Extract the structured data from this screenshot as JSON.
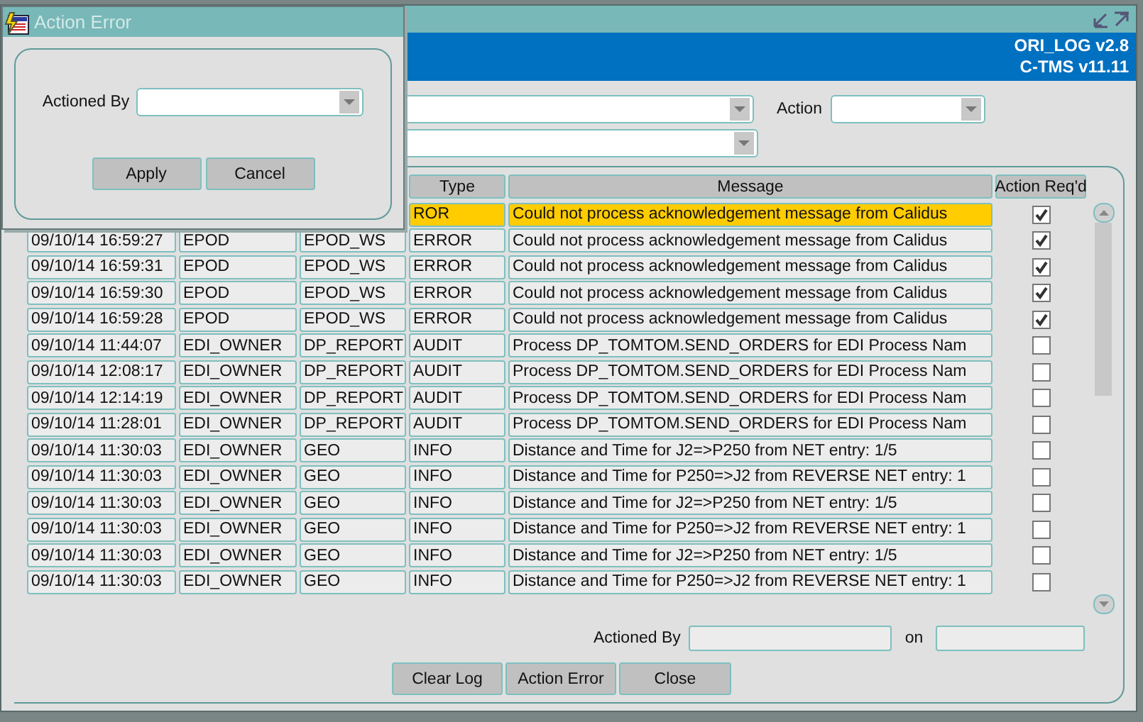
{
  "window": {
    "banner_lines": [
      "ORI_LOG v2.8",
      "C-TMS v11.11"
    ]
  },
  "filters": {
    "action_label": "Action"
  },
  "table": {
    "columns": [
      "Type",
      "Message",
      "Action Req'd"
    ],
    "rows": [
      {
        "type": "ROR",
        "message": "Could not process acknowledgement message from Calidus",
        "action_required": true,
        "selected": true
      },
      {
        "time": "09/10/14 16:59:27",
        "user": "EPOD",
        "module": "EPOD_WS",
        "type": "ERROR",
        "message": "Could not process acknowledgement message from Calidus",
        "action_required": true,
        "selected": false
      },
      {
        "time": "09/10/14 16:59:31",
        "user": "EPOD",
        "module": "EPOD_WS",
        "type": "ERROR",
        "message": "Could not process acknowledgement message from Calidus",
        "action_required": true,
        "selected": false
      },
      {
        "time": "09/10/14 16:59:30",
        "user": "EPOD",
        "module": "EPOD_WS",
        "type": "ERROR",
        "message": "Could not process acknowledgement message from Calidus",
        "action_required": true,
        "selected": false
      },
      {
        "time": "09/10/14 16:59:28",
        "user": "EPOD",
        "module": "EPOD_WS",
        "type": "ERROR",
        "message": "Could not process acknowledgement message from Calidus",
        "action_required": true,
        "selected": false
      },
      {
        "time": "09/10/14 11:44:07",
        "user": "EDI_OWNER",
        "module": "DP_REPORT",
        "type": "AUDIT",
        "message": "Process DP_TOMTOM.SEND_ORDERS for EDI Process Nam",
        "action_required": false,
        "selected": false
      },
      {
        "time": "09/10/14 12:08:17",
        "user": "EDI_OWNER",
        "module": "DP_REPORT",
        "type": "AUDIT",
        "message": "Process DP_TOMTOM.SEND_ORDERS for EDI Process Nam",
        "action_required": false,
        "selected": false
      },
      {
        "time": "09/10/14 12:14:19",
        "user": "EDI_OWNER",
        "module": "DP_REPORT",
        "type": "AUDIT",
        "message": "Process DP_TOMTOM.SEND_ORDERS for EDI Process Nam",
        "action_required": false,
        "selected": false
      },
      {
        "time": "09/10/14 11:28:01",
        "user": "EDI_OWNER",
        "module": "DP_REPORT",
        "type": "AUDIT",
        "message": "Process DP_TOMTOM.SEND_ORDERS for EDI Process Nam",
        "action_required": false,
        "selected": false
      },
      {
        "time": "09/10/14 11:30:03",
        "user": "EDI_OWNER",
        "module": "GEO",
        "type": "INFO",
        "message": "Distance and Time for J2=>P250 from NET entry: 1/5",
        "action_required": false,
        "selected": false
      },
      {
        "time": "09/10/14 11:30:03",
        "user": "EDI_OWNER",
        "module": "GEO",
        "type": "INFO",
        "message": "Distance and Time for P250=>J2 from REVERSE NET entry: 1",
        "action_required": false,
        "selected": false
      },
      {
        "time": "09/10/14 11:30:03",
        "user": "EDI_OWNER",
        "module": "GEO",
        "type": "INFO",
        "message": "Distance and Time for J2=>P250 from NET entry: 1/5",
        "action_required": false,
        "selected": false
      },
      {
        "time": "09/10/14 11:30:03",
        "user": "EDI_OWNER",
        "module": "GEO",
        "type": "INFO",
        "message": "Distance and Time for P250=>J2 from REVERSE NET entry: 1",
        "action_required": false,
        "selected": false
      },
      {
        "time": "09/10/14 11:30:03",
        "user": "EDI_OWNER",
        "module": "GEO",
        "type": "INFO",
        "message": "Distance and Time for J2=>P250 from NET entry: 1/5",
        "action_required": false,
        "selected": false
      },
      {
        "time": "09/10/14 11:30:03",
        "user": "EDI_OWNER",
        "module": "GEO",
        "type": "INFO",
        "message": "Distance and Time for P250=>J2 from REVERSE NET entry: 1",
        "action_required": false,
        "selected": false
      }
    ]
  },
  "footer": {
    "actioned_by_label": "Actioned By",
    "on_label": "on",
    "buttons": [
      "Clear Log",
      "Action Error",
      "Close"
    ]
  },
  "dialog": {
    "title": "Action Error",
    "field_label": "Actioned By",
    "buttons": [
      "Apply",
      "Cancel"
    ]
  }
}
